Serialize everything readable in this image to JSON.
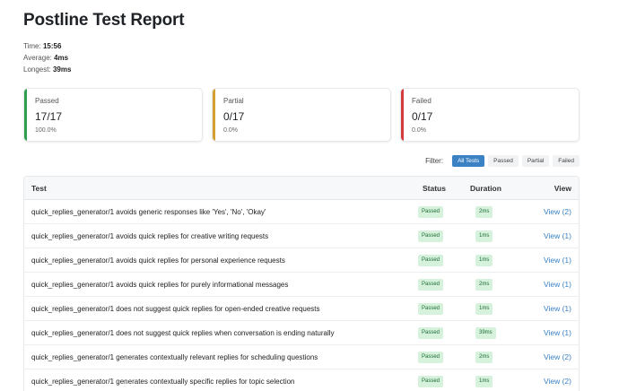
{
  "title": "Postline Test Report",
  "meta": {
    "time_label": "Time:",
    "time_value": "15:56",
    "average_label": "Average:",
    "average_value": "4ms",
    "longest_label": "Longest:",
    "longest_value": "39ms"
  },
  "cards": [
    {
      "label": "Passed",
      "value": "17/17",
      "percent": "100.0%",
      "color": "#2e9e4f"
    },
    {
      "label": "Partial",
      "value": "0/17",
      "percent": "0.0%",
      "color": "#d4a032"
    },
    {
      "label": "Failed",
      "value": "0/17",
      "percent": "0.0%",
      "color": "#d33a3a"
    }
  ],
  "filter": {
    "label": "Filter:",
    "options": [
      "All Tests",
      "Passed",
      "Partial",
      "Failed"
    ],
    "selected": "All Tests"
  },
  "table": {
    "headers": {
      "test": "Test",
      "status": "Status",
      "duration": "Duration",
      "view": "View"
    },
    "rows": [
      {
        "test": "quick_replies_generator/1 avoids generic responses like 'Yes', 'No', 'Okay'",
        "status": "Passed",
        "duration": "2ms",
        "view": "View (2)"
      },
      {
        "test": "quick_replies_generator/1 avoids quick replies for creative writing requests",
        "status": "Passed",
        "duration": "1ms",
        "view": "View (1)"
      },
      {
        "test": "quick_replies_generator/1 avoids quick replies for personal experience requests",
        "status": "Passed",
        "duration": "1ms",
        "view": "View (1)"
      },
      {
        "test": "quick_replies_generator/1 avoids quick replies for purely informational messages",
        "status": "Passed",
        "duration": "2ms",
        "view": "View (1)"
      },
      {
        "test": "quick_replies_generator/1 does not suggest quick replies for open-ended creative requests",
        "status": "Passed",
        "duration": "1ms",
        "view": "View (1)"
      },
      {
        "test": "quick_replies_generator/1 does not suggest quick replies when conversation is ending naturally",
        "status": "Passed",
        "duration": "39ms",
        "view": "View (1)"
      },
      {
        "test": "quick_replies_generator/1 generates contextually relevant replies for scheduling questions",
        "status": "Passed",
        "duration": "2ms",
        "view": "View (2)"
      },
      {
        "test": "quick_replies_generator/1 generates contextually specific replies for topic selection",
        "status": "Passed",
        "duration": "1ms",
        "view": "View (2)"
      }
    ]
  }
}
